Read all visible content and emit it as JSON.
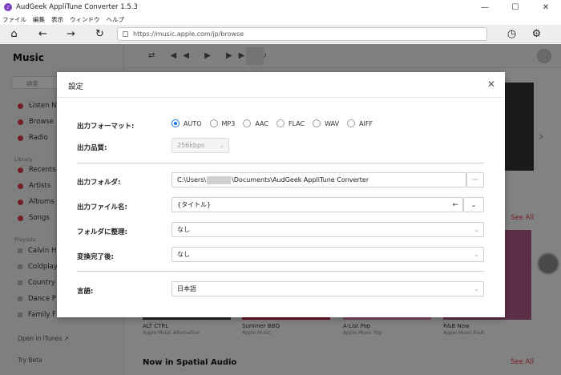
{
  "window": {
    "title": "AudGeek AppliTune Converter 1.5.3",
    "controls": [
      "—",
      "☐",
      "✕"
    ]
  },
  "menu": [
    "ファイル",
    "編集",
    "表示",
    "ウィンドウ",
    "ヘルプ"
  ],
  "toolbar": {
    "url": "https://music.apple.com/jp/browse"
  },
  "background": {
    "logo": "Music",
    "search_placeholder": "検索",
    "sidebar_items": [
      "Listen N",
      "Browse",
      "Radio"
    ],
    "library_heading": "Library",
    "library_items": [
      "Recents",
      "Artists",
      "Albums",
      "Songs"
    ],
    "playlists_heading": "Playlists",
    "playlist_items": [
      "Calvin H",
      "Coldplay",
      "Country",
      "Dance P",
      "Family F"
    ],
    "open_itunes": "Open in iTunes ↗",
    "try_beta": "Try Beta",
    "see_all_1": "See All",
    "see_all_2": "See All",
    "cards": [
      {
        "title": "ALT CTRL",
        "sub": "Apple Music Alternative"
      },
      {
        "title": "Summer BBQ",
        "sub": "Apple Music"
      },
      {
        "title": "A-List Pop",
        "sub": "Apple Music Pop"
      },
      {
        "title": "R&B Now",
        "sub": "Apple Music R&B"
      }
    ],
    "section_title": "Now in Spatial Audio"
  },
  "dialog": {
    "title": "設定",
    "close": "✕",
    "format_label": "出力フォーマット:",
    "formats": [
      "AUTO",
      "MP3",
      "AAC",
      "FLAC",
      "WAV",
      "AIFF"
    ],
    "selected_format": "AUTO",
    "quality_label": "出力品質:",
    "quality_value": "256kbps",
    "folder_label": "出力フォルダ:",
    "folder_prefix": "C:\\Users\\",
    "folder_suffix": "\\Documents\\AudGeek AppliTune Converter",
    "browse_label": "···",
    "filename_label": "出力ファイル名:",
    "filename_value": "{タイトル}",
    "filename_back": "←",
    "filename_expand": "⌄",
    "organize_label": "フォルダに整理:",
    "organize_value": "なし",
    "after_label": "変換完了後:",
    "after_value": "なし",
    "language_label": "言語:",
    "language_value": "日本語"
  }
}
